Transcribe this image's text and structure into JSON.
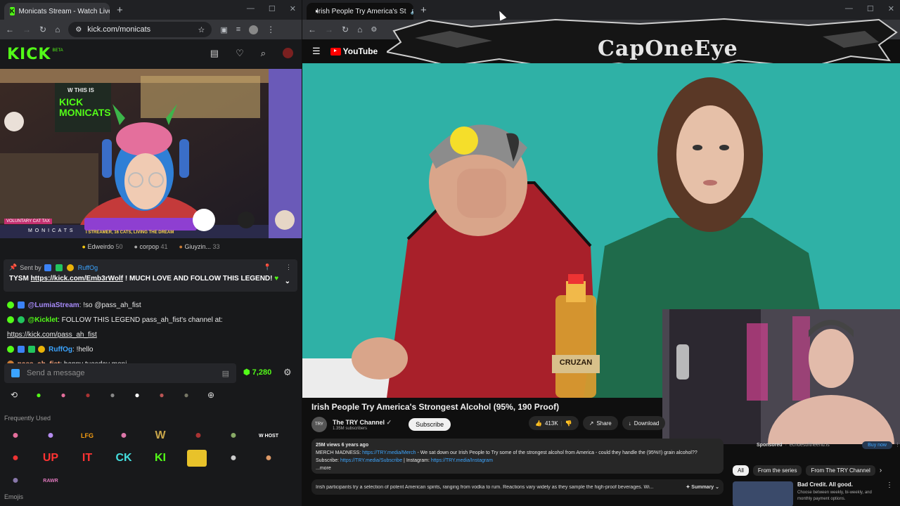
{
  "left_window": {
    "tab_title": "Monicats Stream - Watch Live o",
    "url": "kick.com/monicats",
    "kick_logo": "KICK",
    "beta": "BETA",
    "leaderboard": [
      {
        "name": "Edweirdo",
        "value": "50"
      },
      {
        "name": "corpop",
        "value": "41"
      },
      {
        "name": "Giuyzin...",
        "value": "33"
      }
    ],
    "pinned": {
      "sent_by": "Sent by",
      "sender": "RuffOg",
      "message_prefix": "TYSM ",
      "link": "https://kick.com/Emb3rWolf",
      "message_suffix": " ! MUCH LOVE AND FOLLOW THIS LEGEND!"
    },
    "chat": [
      {
        "user": "@LumiaStream",
        "text": ": !so @pass_ah_fist",
        "color": "#a78bfa"
      },
      {
        "user": "@Kicklet",
        "text": ": FOLLOW THIS LEGEND pass_ah_fist's channel at: ",
        "link": "https://kick.com/pass_ah_fist",
        "color": "#53fc18"
      },
      {
        "user": "RuffOg",
        "text": ": !hello",
        "color": "#3ba4ff"
      },
      {
        "user": "pass_ah_fist",
        "text": ": happy tuesday moni",
        "color": "#f7a37c"
      }
    ],
    "message_placeholder": "Send a message",
    "points": "7,280",
    "frequently_used": "Frequently Used",
    "emojis": "Emojis",
    "emote_text": [
      "W",
      "UP",
      "IT",
      "CK",
      "KI",
      "LFG",
      "W HOST",
      "RAWR"
    ],
    "stream_overlay": {
      "streamer_name": "M O N I C A T S",
      "banner_text": "I STREAMER, 16 CATS, LIVING THE DREAM",
      "voluntary_tax": "VOLUNTARY CAT TAX",
      "sign_text": "KICK MONICATS",
      "this_is": "W THIS IS"
    }
  },
  "right_window": {
    "tab_title": "Irish People Try America's St",
    "youtube": "YouTube",
    "banner_text": "CapOneEye",
    "video_title": "Irish People Try America's Strongest Alcohol (95%, 190 Proof)",
    "channel": "The TRY Channel",
    "subscribers": "1.35M subscribers",
    "subscribe": "Subscribe",
    "likes": "413K",
    "share": "Share",
    "download": "Download",
    "views_date": "25M views  6 years ago",
    "desc_line1_prefix": "MERCH MADNESS: ",
    "desc_link1": "https://TRY.media/Merch",
    "desc_line1_suffix": " - We sat down our Irish People to Try some of the strongest alcohol from America - could they handle the (95%!!) grain alcohol??",
    "desc_line2_prefix": "Subscribe: ",
    "desc_link2": "https://TRY.media/Subscribe",
    "desc_line2_mid": " | Instagram: ",
    "desc_link3": "https://TRY.media/Instagram",
    "more": "...more",
    "ai_summary": "Irish participants try a selection of potent American spirits, ranging from vodka to rum. Reactions vary widely as they sample the high-proof beverages. Wi...",
    "summary_btn": "Summary",
    "sponsored": "Sponsored",
    "sponsor_domain": "echoesoftheend.is",
    "buy_now": "Buy now",
    "chips": [
      "All",
      "From the series",
      "From The TRY Channel"
    ],
    "rec_title": "Bad Credit. All good.",
    "rec_sub": "Choose between weekly, bi-weekly, and monthly payment options.",
    "bottle_label": "CRUZAN"
  }
}
